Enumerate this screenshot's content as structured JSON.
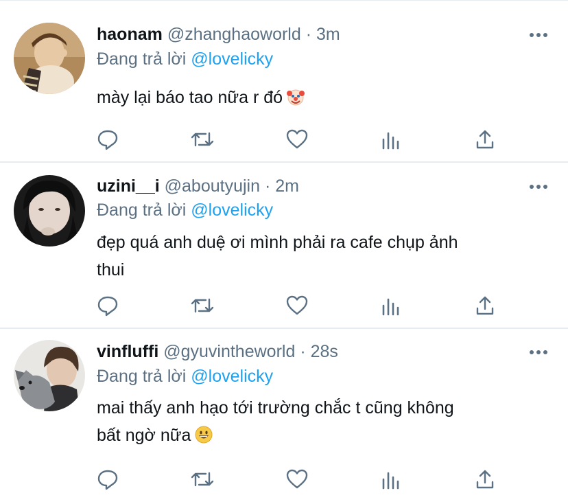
{
  "replies": [
    {
      "display_name": "haonam",
      "handle": "@zhanghaoworld",
      "separator": "·",
      "time": "3m",
      "reply_prefix": "Đang trả lời",
      "reply_to": "@lovelicky",
      "text": "mày lại báo tao nữa r đó",
      "emoji": "clown-face-icon"
    },
    {
      "display_name": "uzini__i",
      "handle": "@aboutyujin",
      "separator": "·",
      "time": "2m",
      "reply_prefix": "Đang trả lời",
      "reply_to": "@lovelicky",
      "text_line1": "đẹp quá anh duệ ơi mình phải ra cafe chụp ảnh",
      "text_line2": "thui"
    },
    {
      "display_name": "vinfluffi",
      "handle": "@gyuvintheworld",
      "separator": "·",
      "time": "28s",
      "reply_prefix": "Đang trả lời",
      "reply_to": "@lovelicky",
      "text_line1": "mai thấy anh hạo tới trường chắc t cũng không",
      "text_line2": "bất ngờ nữa",
      "emoji": "grinning-face-icon"
    }
  ],
  "colors": {
    "text": "#0f1419",
    "muted": "#5b7083",
    "link": "#1da1f2",
    "divider": "#e6ecf0"
  }
}
